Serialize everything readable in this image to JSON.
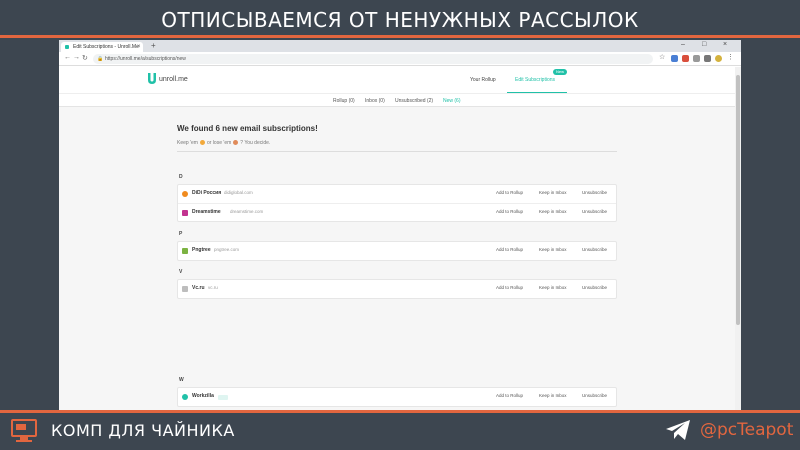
{
  "banner": {
    "title": "ОТПИСЫВАЕМСЯ ОТ НЕНУЖНЫХ РАССЫЛОК",
    "footer_brand": "КОМП ДЛЯ ЧАЙНИКА",
    "handle": "@pcTeapot",
    "accent_color": "#e2663f"
  },
  "browser": {
    "tab_title": "Edit Subscriptions - Unroll.Me",
    "tab_close": "×",
    "new_tab": "+",
    "url": "https://unroll.me/a/subscriptions/new",
    "controls": {
      "minimize": "–",
      "maximize": "□",
      "close": "×"
    },
    "nav": {
      "back": "←",
      "forward": "→",
      "reload": "↻"
    }
  },
  "site": {
    "logo_text": "unroll.me",
    "brand_color": "#20c1a8",
    "header": {
      "rollup": "Your Rollup",
      "edit_subscriptions": "Edit Subscriptions",
      "badge": "New"
    },
    "subnav": [
      {
        "label": "Rollup (0)",
        "active": false
      },
      {
        "label": "Inbox (0)",
        "active": false
      },
      {
        "label": "Unsubscribed (2)",
        "active": false
      },
      {
        "label": "New (6)",
        "active": true
      }
    ],
    "headline": "We found 6 new email subscriptions!",
    "hint_prefix": "Keep 'em",
    "hint_middle": "or lose 'em",
    "hint_suffix": "? You decide."
  },
  "actions": {
    "add_to_rollup": "Add to Rollup",
    "keep_in_inbox": "Keep in Inbox",
    "unsubscribe": "Unsubscribe"
  },
  "groups": [
    {
      "letter": "D",
      "items": [
        {
          "name": "DiDi Россия",
          "domain": "didiglobal.com",
          "icon": "didi-icon",
          "color": "#f08b1f"
        },
        {
          "name": "Dreamstime",
          "domain": "dreamstime.com",
          "icon": "dreamstime-icon",
          "color": "#c2338f"
        }
      ]
    },
    {
      "letter": "P",
      "items": [
        {
          "name": "Pngtree",
          "domain": "pngtree.com",
          "icon": "pngtree-icon",
          "color": "#7cb342"
        }
      ]
    },
    {
      "letter": "V",
      "items": [
        {
          "name": "Vc.ru",
          "domain": "vc.ru",
          "icon": "vc-icon",
          "color": "#bdbdbd"
        }
      ]
    },
    {
      "letter": "W",
      "items": [
        {
          "name": "Workzilla",
          "domain": "",
          "icon": "workzilla-icon",
          "color": "#20c1a8"
        }
      ]
    }
  ]
}
